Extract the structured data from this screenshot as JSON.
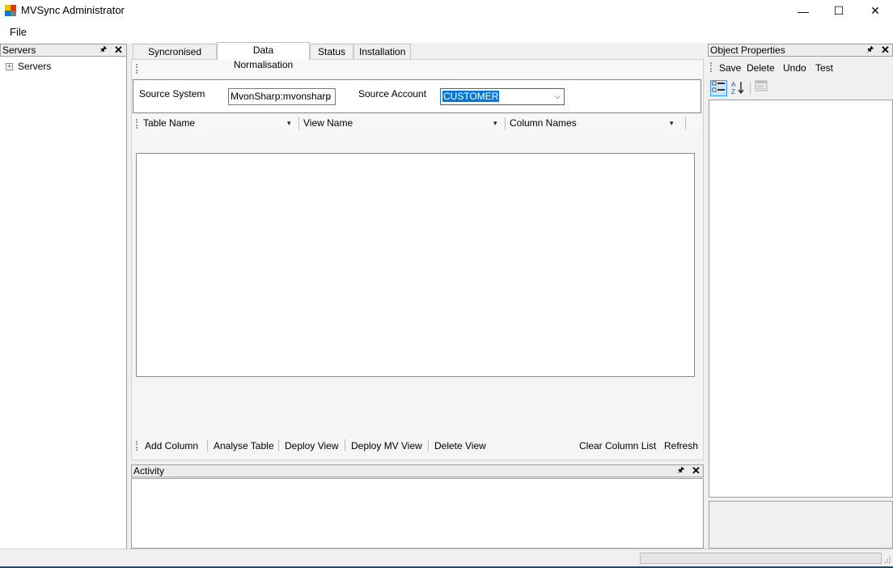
{
  "window": {
    "title": "MVSync Administrator",
    "minimize_icon": "—",
    "maximize_icon": "☐",
    "close_icon": "✕"
  },
  "menu": {
    "file": "File"
  },
  "servers_panel": {
    "title": "Servers",
    "tree_root": "Servers",
    "expand_glyph": "+"
  },
  "tabs": [
    {
      "label": "Syncronised Files"
    },
    {
      "label": "Data Normalisation"
    },
    {
      "label": "Status"
    },
    {
      "label": "Installation"
    }
  ],
  "source": {
    "system_label": "Source System",
    "system_value": "MvonSharp:mvonsharp",
    "account_label": "Source Account",
    "account_value": "CUSTOMER"
  },
  "columns_strip": {
    "table_name": "Table Name",
    "view_name": "View Name",
    "column_names": "Column Names"
  },
  "bottom_toolbar": {
    "add_column": "Add Column",
    "analyse_table": "Analyse Table",
    "deploy_view": "Deploy View",
    "deploy_mv_view": "Deploy MV View",
    "delete_view": "Delete View",
    "clear_column_list": "Clear Column List",
    "refresh": "Refresh"
  },
  "activity_panel": {
    "title": "Activity"
  },
  "properties_panel": {
    "title": "Object Properties",
    "save": "Save",
    "delete": "Delete",
    "undo": "Undo",
    "test": "Test"
  },
  "glyphs": {
    "pin": "🖈",
    "close": "✕",
    "dropdown": "▾",
    "chevron": "⌵"
  },
  "colors": {
    "selection": "#0078d7",
    "accent_line": "#1f4a6e"
  }
}
